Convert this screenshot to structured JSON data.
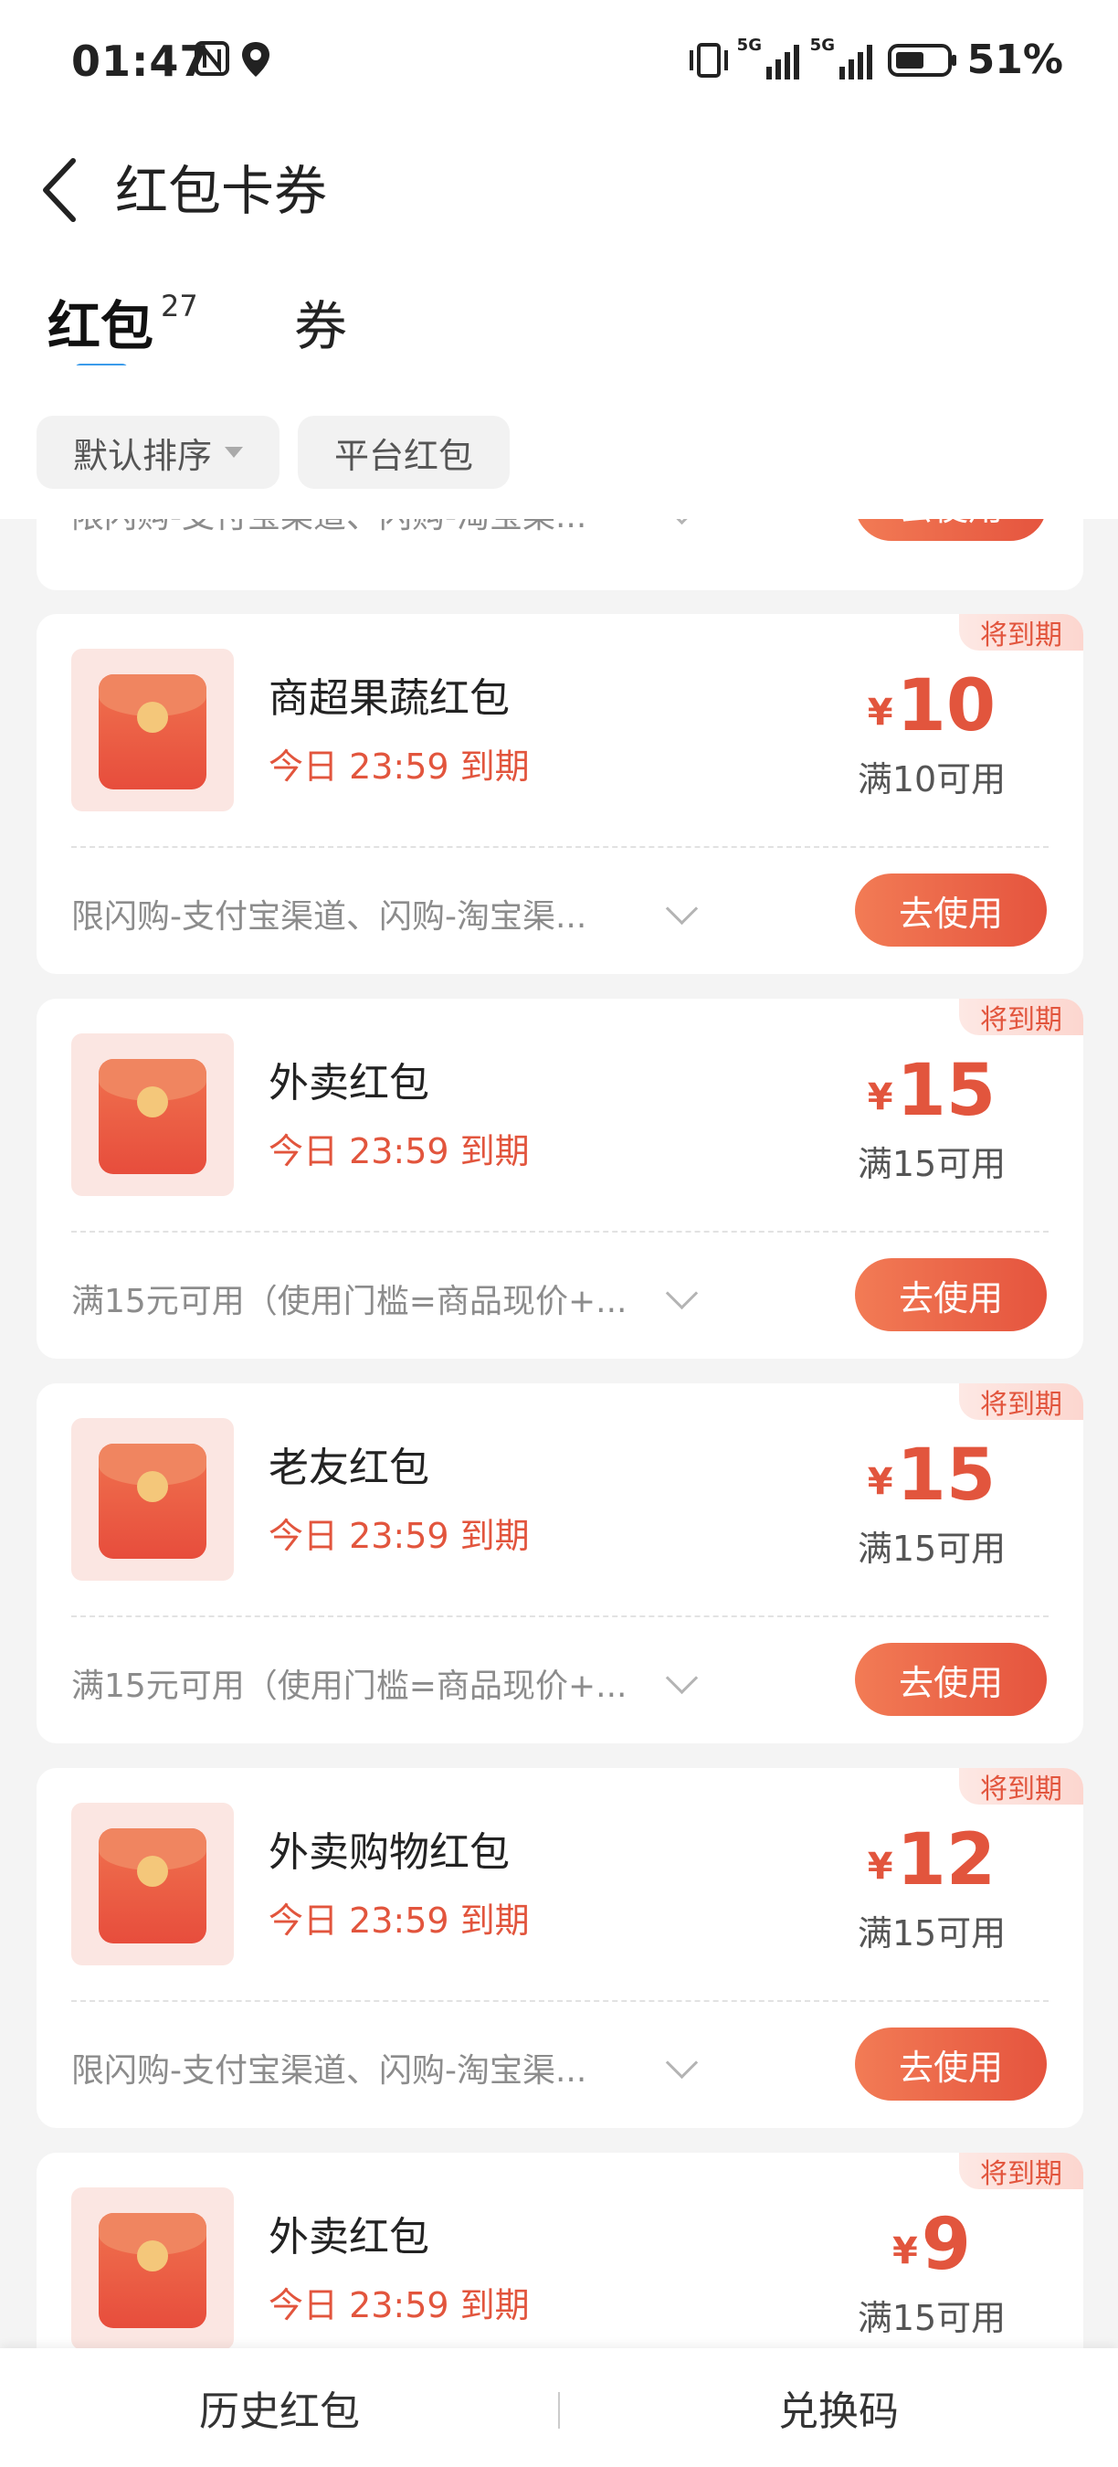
{
  "status_bar": {
    "time": "01:47",
    "icons_left": [
      "nfc-icon",
      "location-icon"
    ],
    "icons_right": [
      "vibrate-icon",
      "signal-5g-icon",
      "signal-5g-icon",
      "battery-icon"
    ],
    "network_1": "5G",
    "network_2": "5G",
    "battery": "51%"
  },
  "header": {
    "title": "红包卡券",
    "back_icon": "back-arrow-icon"
  },
  "tabs": [
    {
      "label": "红包",
      "count": "27",
      "active": true
    },
    {
      "label": "券",
      "active": false
    }
  ],
  "filters": {
    "sort_label": "默认排序",
    "platform_label": "平台红包"
  },
  "partial_card": {
    "desc": "限闪购-支付宝渠道、闪购-淘宝渠...",
    "button": "去使用"
  },
  "cards": [
    {
      "badge": "将到期",
      "name": "商超果蔬红包",
      "expire": "今日 23:59 到期",
      "currency": "¥",
      "amount": "10",
      "condition": "满10可用",
      "desc": "限闪购-支付宝渠道、闪购-淘宝渠...",
      "button": "去使用"
    },
    {
      "badge": "将到期",
      "name": "外卖红包",
      "expire": "今日 23:59 到期",
      "currency": "¥",
      "amount": "15",
      "condition": "满15可用",
      "desc": "满15元可用（使用门槛=商品现价+...",
      "button": "去使用"
    },
    {
      "badge": "将到期",
      "name": "老友红包",
      "expire": "今日 23:59 到期",
      "currency": "¥",
      "amount": "15",
      "condition": "满15可用",
      "desc": "满15元可用（使用门槛=商品现价+...",
      "button": "去使用"
    },
    {
      "badge": "将到期",
      "name": "外卖购物红包",
      "expire": "今日 23:59 到期",
      "currency": "¥",
      "amount": "12",
      "condition": "满15可用",
      "desc": "限闪购-支付宝渠道、闪购-淘宝渠...",
      "button": "去使用"
    },
    {
      "badge": "将到期",
      "name": "外卖红包",
      "expire": "今日 23:59 到期",
      "currency": "¥",
      "amount": "9",
      "condition": "满15可用",
      "desc": "",
      "button": ""
    }
  ],
  "bottom_bar": {
    "history": "历史红包",
    "redeem_code": "兑换码"
  },
  "colors": {
    "accent": "#e5543e",
    "tab_indicator": "#3b9bea",
    "badge_bg": "#fde8e4"
  }
}
